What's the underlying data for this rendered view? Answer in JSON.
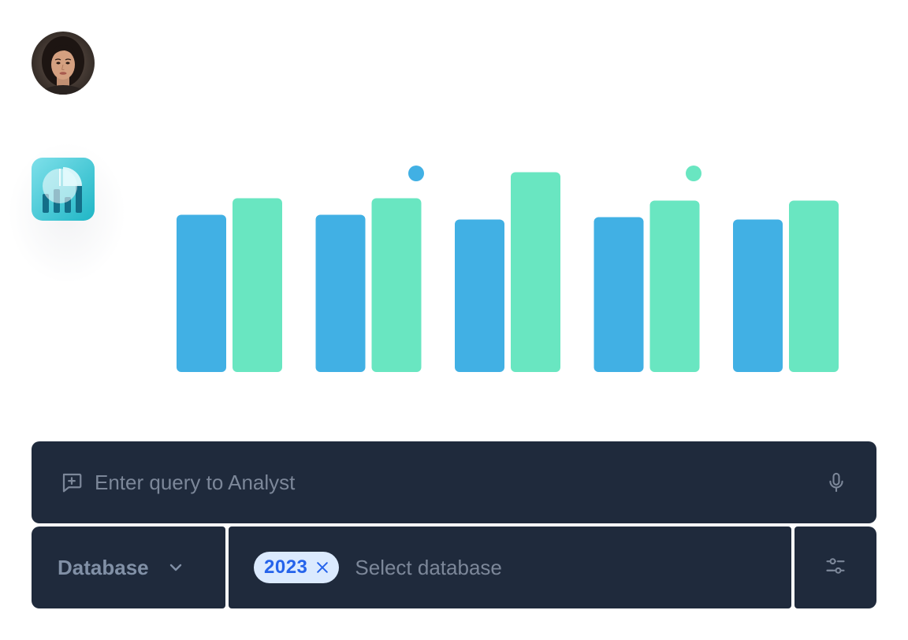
{
  "query": {
    "placeholder": "Enter query to Analyst",
    "value": ""
  },
  "database_selector": {
    "label": "Database",
    "selected_chip": "2023",
    "placeholder": "Select database"
  },
  "icons": {
    "query": "chat-add-icon",
    "microphone": "microphone-icon",
    "dropdown": "chevron-down-icon",
    "chip_remove": "close-icon",
    "filters": "sliders-icon"
  },
  "colors": {
    "series_a": "#41b0e4",
    "series_b": "#69e6c1",
    "panel_bg": "#1f2a3c",
    "chip_bg": "#dbeafe",
    "chip_text": "#2563eb"
  },
  "chart_data": {
    "type": "bar",
    "title": "",
    "xlabel": "",
    "ylabel": "",
    "categories": [
      "",
      "",
      "",
      "",
      ""
    ],
    "ylim": [
      0,
      200
    ],
    "grid": false,
    "legend": "top",
    "series": [
      {
        "color": "#41b0e4",
        "values": [
          133,
          133,
          129,
          131,
          129
        ]
      },
      {
        "color": "#69e6c1",
        "values": [
          147,
          147,
          169,
          145,
          145
        ]
      }
    ]
  }
}
